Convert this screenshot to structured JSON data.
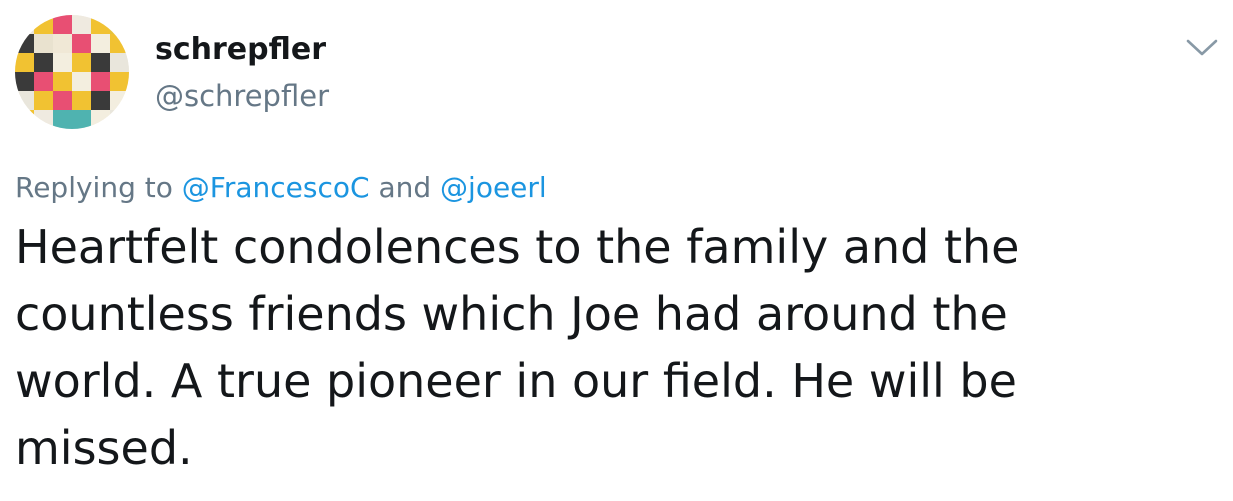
{
  "author": {
    "display_name": "schrepfler",
    "handle": "@schrepfler",
    "avatar_icon": "pixel-art-avatar"
  },
  "menu": {
    "icon": "chevron-down-icon"
  },
  "reply_context": {
    "prefix": "Replying to",
    "mentions": [
      "@FrancescoC",
      "@joeerl"
    ],
    "joiner": "and"
  },
  "tweet": {
    "lines": [
      "Heartfelt condolences to the family and the",
      "countless friends which Joe had around the",
      "world. A true pioneer in our field. He will be",
      "missed."
    ]
  },
  "colors": {
    "text": "#14171a",
    "secondary": "#657786",
    "link": "#1b95e0",
    "background": "#ffffff"
  }
}
